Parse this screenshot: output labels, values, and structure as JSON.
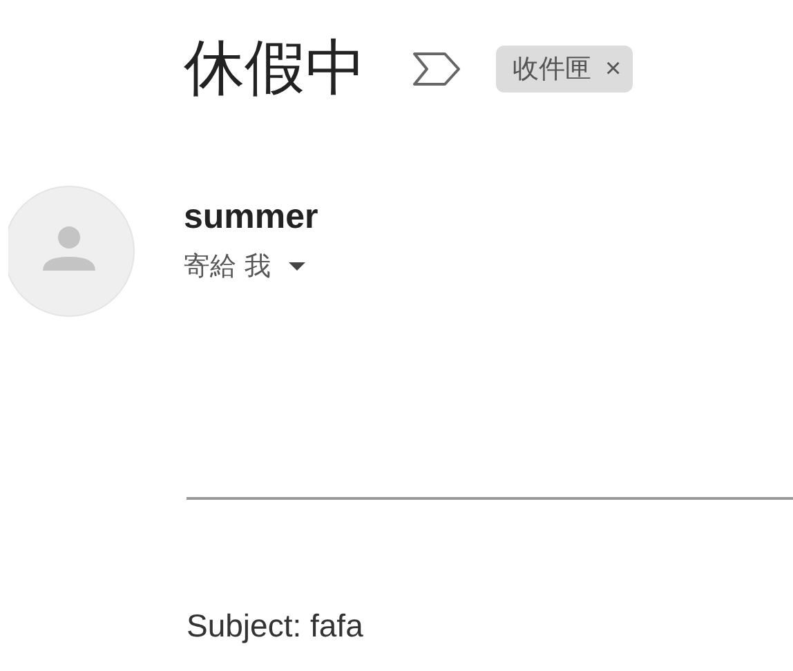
{
  "subject": "休假中",
  "important": false,
  "labels": [
    {
      "text": "收件匣",
      "remove": "×"
    }
  ],
  "sender": {
    "name": "summer",
    "recipients": "寄給 我"
  },
  "body": "Subject: fafa"
}
